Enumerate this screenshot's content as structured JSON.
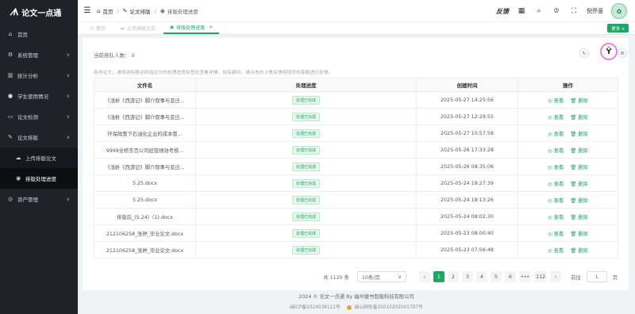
{
  "app": {
    "logo_mark": "ᗑ",
    "name": "论文一点通"
  },
  "sidebar": {
    "items": [
      {
        "label": "首页",
        "icon": "⌂",
        "has_chevron": false
      },
      {
        "label": "系统管理",
        "icon": "⚙",
        "has_chevron": true
      },
      {
        "label": "统计分析",
        "icon": "▥",
        "has_chevron": true
      },
      {
        "label": "学生使用情况",
        "icon": "●",
        "has_chevron": true
      },
      {
        "label": "论文检测",
        "icon": "▭",
        "has_chevron": true
      },
      {
        "label": "论文排版",
        "icon": "✎",
        "has_chevron": true
      }
    ],
    "submenu": [
      {
        "label": "上传排版论文",
        "icon": "☁"
      },
      {
        "label": "排版处理进度",
        "icon": "◉"
      }
    ],
    "after": {
      "label": "资产管理",
      "icon": "◎"
    }
  },
  "header": {
    "breadcrumb": [
      {
        "label": "首页",
        "icon": "⌂"
      },
      {
        "label": "论文排版",
        "icon": "✎"
      },
      {
        "label": "排版处理进度",
        "icon": "◉"
      }
    ],
    "feedback": "反馈",
    "username": "倪乔竖",
    "avatar_glyph": "✿"
  },
  "tabs": [
    {
      "label": "首页",
      "icon": "⌂"
    },
    {
      "label": "上传排版论文",
      "icon": "☁"
    },
    {
      "label": "排版处理进度",
      "icon": "◉",
      "close": "×"
    }
  ],
  "more_label": "更多 ∨",
  "main": {
    "queue_text": "当前排队人数： 0",
    "notice": "若非论文，请将鼠标移动到指论文的处理进度标签处查看详情。如有疑问，请点击右上角反馈按钮添加客服进行反馈。",
    "columns": [
      "文件名",
      "处理进度",
      "创建时间",
      "操作"
    ],
    "view_label": "◎ 查看",
    "delete_label": "🗑 删除",
    "rows": [
      {
        "file": "《浅析《西游记》脚介叙事与变迁...",
        "status": "处理已完成",
        "time": "2025-05-27 14:25:56"
      },
      {
        "file": "《浅析《西游记》脚介叙事与变迁...",
        "status": "处理已完成",
        "time": "2025-05-27 12:29:55"
      },
      {
        "file": "环保政策下石油化企业的成本管...",
        "status": "处理已完成",
        "time": "2025-05-27 10:57:58"
      },
      {
        "file": "9999全桥东百公司经营绩效考核...",
        "status": "处理已完成",
        "time": "2025-05-26 17:33:28"
      },
      {
        "file": "《浅析《西游记》脚介叙事与变迁...",
        "status": "处理已完成",
        "time": "2025-05-26 08:35:06"
      },
      {
        "file": "5.25.docx",
        "status": "处理已完成",
        "time": "2025-05-24 18:27:39"
      },
      {
        "file": "5.25.docx",
        "status": "处理已完成",
        "time": "2025-05-24 18:13:26"
      },
      {
        "file": "排版后_(5.24)（1).docx",
        "status": "处理已完成",
        "time": "2025-05-24 08:02:30"
      },
      {
        "file": "212106258_张婷_毕业论文.docx",
        "status": "处理已完成",
        "time": "2025-05-23 08:00:40"
      },
      {
        "file": "212106258_张婷_毕业论文.docx",
        "status": "处理已完成",
        "time": "2025-05-23 07:56:48"
      }
    ]
  },
  "pagination": {
    "total": "共 1120 条",
    "page_size": "10条/页",
    "prev": "‹",
    "next": "›",
    "pages": [
      "1",
      "2",
      "3",
      "4",
      "5",
      "6",
      "•••",
      "112"
    ],
    "goto_label": "前往",
    "goto_value": "1",
    "goto_suffix": "页"
  },
  "footer": {
    "line1": "2024 © 论文一点通 By 福州捷书智能科技有限公司",
    "icp": "闽ICP备2024038121号",
    "police": "闽公网安备35010202001797号"
  },
  "colors": {
    "accent": "#20a565",
    "sidebar_bg": "#1f2329"
  }
}
